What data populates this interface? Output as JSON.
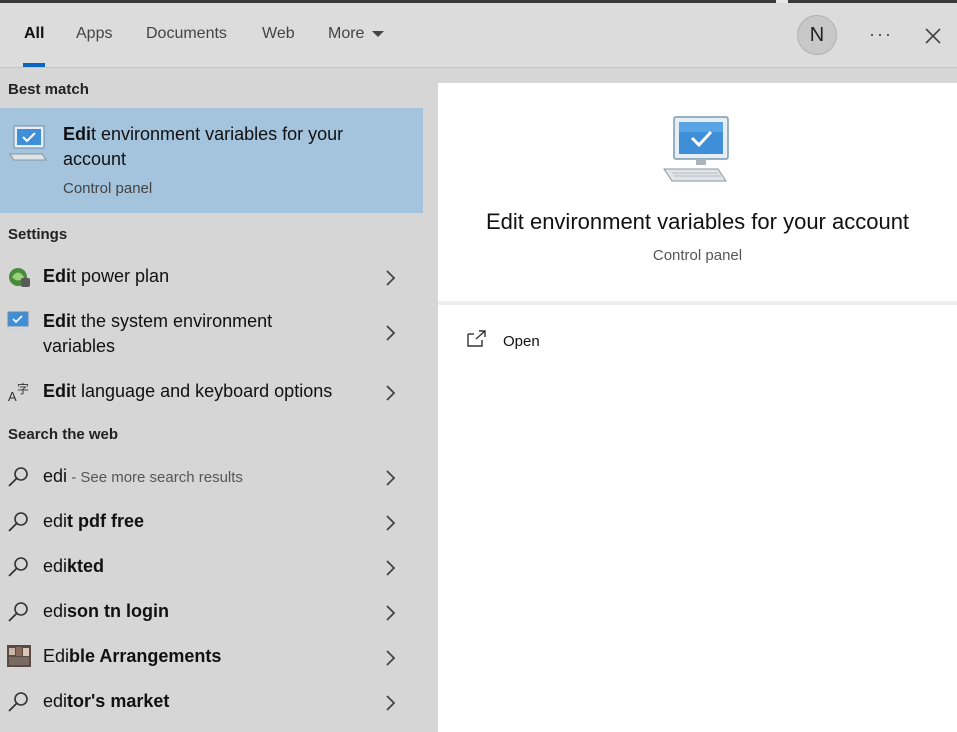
{
  "tabs": [
    {
      "label": "All",
      "active": true
    },
    {
      "label": "Apps",
      "active": false
    },
    {
      "label": "Documents",
      "active": false
    },
    {
      "label": "Web",
      "active": false
    },
    {
      "label": "More",
      "active": false
    }
  ],
  "header": {
    "avatar_initial": "N",
    "more_options": "···",
    "accent_color": "#0a66c2"
  },
  "best_match": {
    "heading": "Best match",
    "title_match": "Edi",
    "title_rest": "t environment variables for your account",
    "subtitle": "Control panel",
    "icon": "monitor-check-icon",
    "highlight_color": "#a4c3dc"
  },
  "settings": {
    "heading": "Settings",
    "items": [
      {
        "match": "Edi",
        "rest": "t power plan",
        "icon": "power-plan-icon"
      },
      {
        "match": "Edi",
        "rest": "t the system environment variables",
        "icon": "monitor-icon"
      },
      {
        "match": "Edi",
        "rest": "t language and keyboard options",
        "icon": "language-icon"
      }
    ]
  },
  "web": {
    "heading": "Search the web",
    "items": [
      {
        "typed": "edi",
        "suggest": "",
        "hint": " - See more search results",
        "icon": "search-icon"
      },
      {
        "typed": "edi",
        "suggest": "t pdf free",
        "hint": "",
        "icon": "search-icon"
      },
      {
        "typed": "edi",
        "suggest": "kted",
        "hint": "",
        "icon": "search-icon"
      },
      {
        "typed": "edi",
        "suggest": "son tn login",
        "hint": "",
        "icon": "search-icon"
      },
      {
        "typed": "Edi",
        "suggest": "ble Arrangements",
        "hint": "",
        "icon": "thumbnail-icon"
      },
      {
        "typed": "edi",
        "suggest": "tor's market",
        "hint": "",
        "icon": "search-icon"
      }
    ]
  },
  "preview": {
    "title": "Edit environment variables for your account",
    "subtitle": "Control panel",
    "action_open": "Open",
    "icon": "monitor-check-icon"
  }
}
